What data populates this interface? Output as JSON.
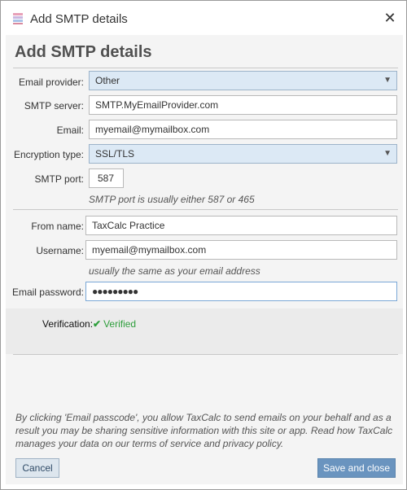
{
  "window": {
    "title": "Add SMTP details",
    "app_icon": "taxcalc-app-icon",
    "close_icon": "close-icon",
    "close_glyph": "✕"
  },
  "dialog": {
    "heading": "Add SMTP details",
    "fields": {
      "email_provider": {
        "label": "Email provider:",
        "value": "Other",
        "arrow": "▼"
      },
      "smtp_server": {
        "label": "SMTP server:",
        "value": "SMTP.MyEmailProvider.com"
      },
      "email": {
        "label": "Email:",
        "value": "myemail@mymailbox.com"
      },
      "encryption_type": {
        "label": "Encryption type:",
        "value": "SSL/TLS",
        "arrow": "▼"
      },
      "smtp_port": {
        "label": "SMTP port:",
        "value": "587",
        "hint": "SMTP port is usually either 587 or 465"
      },
      "from_name": {
        "label": "From name:",
        "value": "TaxCalc Practice"
      },
      "username": {
        "label": "Username:",
        "value": "myemail@mymailbox.com",
        "hint": "usually the same as your email address"
      },
      "email_password": {
        "label": "Email password:",
        "value": "●●●●●●●●●"
      }
    },
    "verification": {
      "label": "Verification:",
      "status": "Verified",
      "check_glyph": "✔",
      "status_color": "#2e9e3c"
    },
    "disclaimer": "By clicking 'Email passcode', you allow TaxCalc to send emails on your behalf and as a result you may be sharing sensitive information with this site or app. Read how TaxCalc manages your data on our terms of service and privacy policy.",
    "buttons": {
      "cancel": "Cancel",
      "save": "Save and close"
    }
  },
  "colors": {
    "select_background": "#dce9f5",
    "primary_button": "#6a94bf",
    "verified_green": "#2e9e3c"
  }
}
